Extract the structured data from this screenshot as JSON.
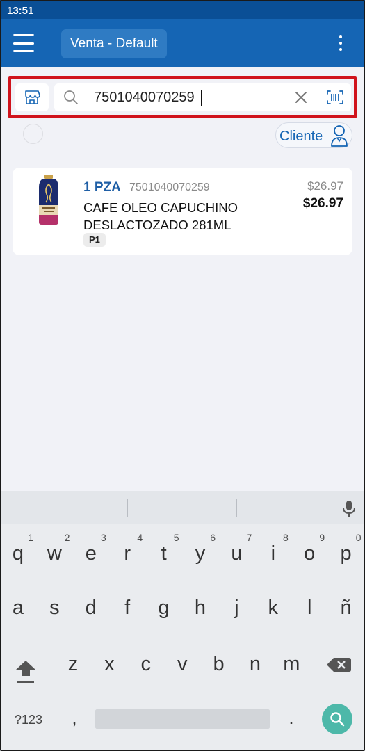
{
  "status_bar": {
    "time": "13:51"
  },
  "app_bar": {
    "title": "Venta - Default"
  },
  "search": {
    "value": "7501040070259"
  },
  "cliente": {
    "label": "Cliente"
  },
  "product": {
    "quantity": "1 PZA",
    "barcode": "7501040070259",
    "name": "CAFE OLEO CAPUCHINO DESLACTOZADO 281ML",
    "badge": "P1",
    "price_original": "$26.97",
    "price": "$26.97"
  },
  "keyboard": {
    "row1": [
      {
        "key": "q",
        "hint": "1"
      },
      {
        "key": "w",
        "hint": "2"
      },
      {
        "key": "e",
        "hint": "3"
      },
      {
        "key": "r",
        "hint": "4"
      },
      {
        "key": "t",
        "hint": "5"
      },
      {
        "key": "y",
        "hint": "6"
      },
      {
        "key": "u",
        "hint": "7"
      },
      {
        "key": "i",
        "hint": "8"
      },
      {
        "key": "o",
        "hint": "9"
      },
      {
        "key": "p",
        "hint": "0"
      }
    ],
    "row2": [
      "a",
      "s",
      "d",
      "f",
      "g",
      "h",
      "j",
      "k",
      "l",
      "ñ"
    ],
    "row3": [
      "z",
      "x",
      "c",
      "v",
      "b",
      "n",
      "m"
    ],
    "symbols_label": "?123",
    "comma": ",",
    "period": "."
  },
  "colors": {
    "status_bar": "#0a4f96",
    "app_bar": "#1565b4",
    "accent": "#1565b4",
    "highlight_border": "#d0131c",
    "search_key": "#4db8a9"
  },
  "icons": {
    "menu": "hamburger-icon",
    "more": "more-vert-icon",
    "store": "store-icon",
    "search": "search-icon",
    "clear": "close-icon",
    "scan": "barcode-scan-icon",
    "cliente": "person-icon",
    "mic": "mic-icon",
    "shift": "shift-icon",
    "backspace": "backspace-icon",
    "keyboard_search": "search-icon"
  }
}
